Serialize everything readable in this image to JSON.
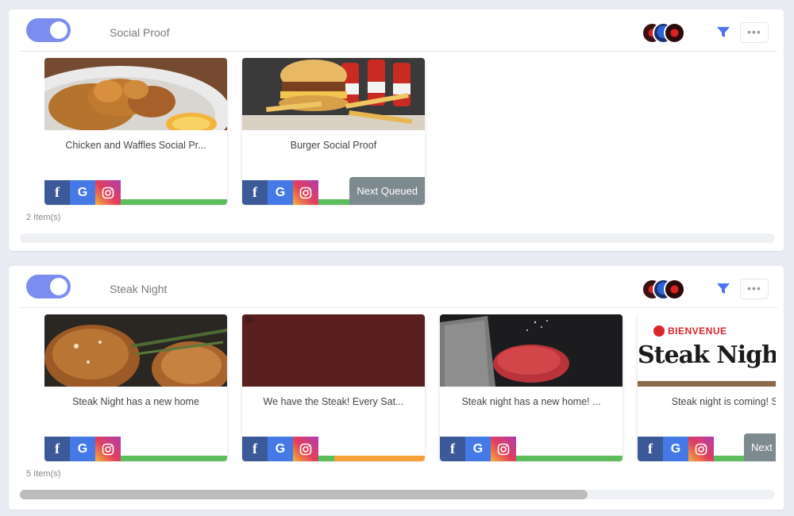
{
  "more_label": "•••",
  "icons": {
    "facebook": "f",
    "google": "G",
    "instagram": "instagram-icon",
    "filter": "filter-icon"
  },
  "colors": {
    "toggle_on": "#7b8ef0",
    "filter": "#4d73f0",
    "progress_done": "#5cbd5b",
    "progress_pending": "#f4a13a",
    "queued_badge": "#7d8a8f"
  },
  "panels": [
    {
      "title": "Social Proof",
      "enabled": true,
      "count_label": "2 Item(s)",
      "cards": [
        {
          "title": "Chicken and Waffles Social Pr...",
          "progress": 1.0
        },
        {
          "title": "Burger Social Proof",
          "progress": 1.0,
          "badge": "Next Queued"
        }
      ]
    },
    {
      "title": "Steak Night",
      "enabled": true,
      "count_label": "5 Item(s)",
      "cards": [
        {
          "title": "Steak Night has a new home",
          "progress": 1.0
        },
        {
          "title": "We have the Steak! Every Sat...",
          "progress": 0.15
        },
        {
          "title": "Steak night has a new home! ...",
          "progress": 1.0
        },
        {
          "title": "Steak night is coming! Ste",
          "progress": 1.0,
          "badge": "Next",
          "image_text_top": "BIENVENUE",
          "image_text_main": "Steak Nigh"
        }
      ]
    }
  ]
}
